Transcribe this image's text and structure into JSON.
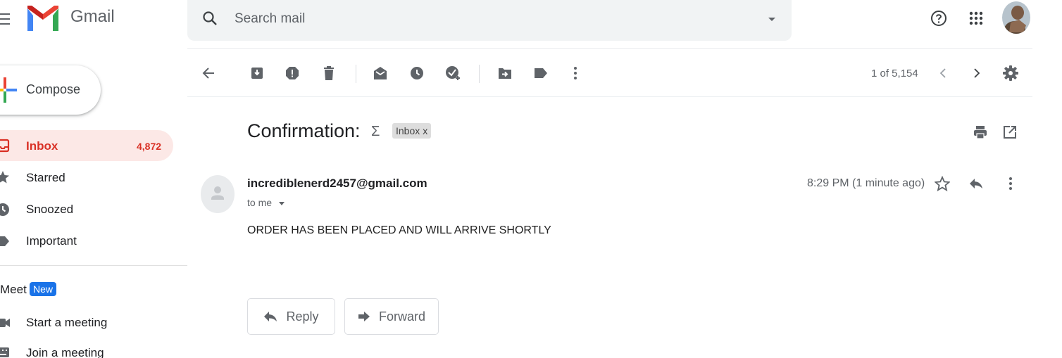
{
  "header": {
    "app_name": "Gmail",
    "search_placeholder": "Search mail"
  },
  "sidebar": {
    "compose_label": "Compose",
    "items": [
      {
        "label": "Inbox",
        "count": "4,872",
        "active": true,
        "icon": "inbox-icon"
      },
      {
        "label": "Starred",
        "count": "",
        "icon": "star-icon"
      },
      {
        "label": "Snoozed",
        "count": "",
        "icon": "clock-icon"
      },
      {
        "label": "Important",
        "count": "",
        "icon": "important-icon"
      }
    ],
    "meet": {
      "title": "Meet",
      "badge": "New",
      "items": [
        {
          "label": "Start a meeting",
          "icon": "video-icon"
        },
        {
          "label": "Join a meeting",
          "icon": "keyboard-icon"
        }
      ]
    }
  },
  "toolbar": {
    "pager": "1 of 5,154"
  },
  "message": {
    "subject": "Confirmation:",
    "importance_marker": "Σ",
    "label": "Inbox",
    "label_remove": "x",
    "sender": "incrediblenerd2457@gmail.com",
    "recipient": "to me",
    "time": "8:29 PM (1 minute ago)",
    "body": "ORDER HAS BEEN PLACED AND WILL ARRIVE SHORTLY",
    "reply_label": "Reply",
    "forward_label": "Forward"
  },
  "colors": {
    "accent_red": "#d93025",
    "active_bg": "#fce8e6",
    "meet_badge": "#1a73e8",
    "icon_gray": "#5f6368"
  }
}
